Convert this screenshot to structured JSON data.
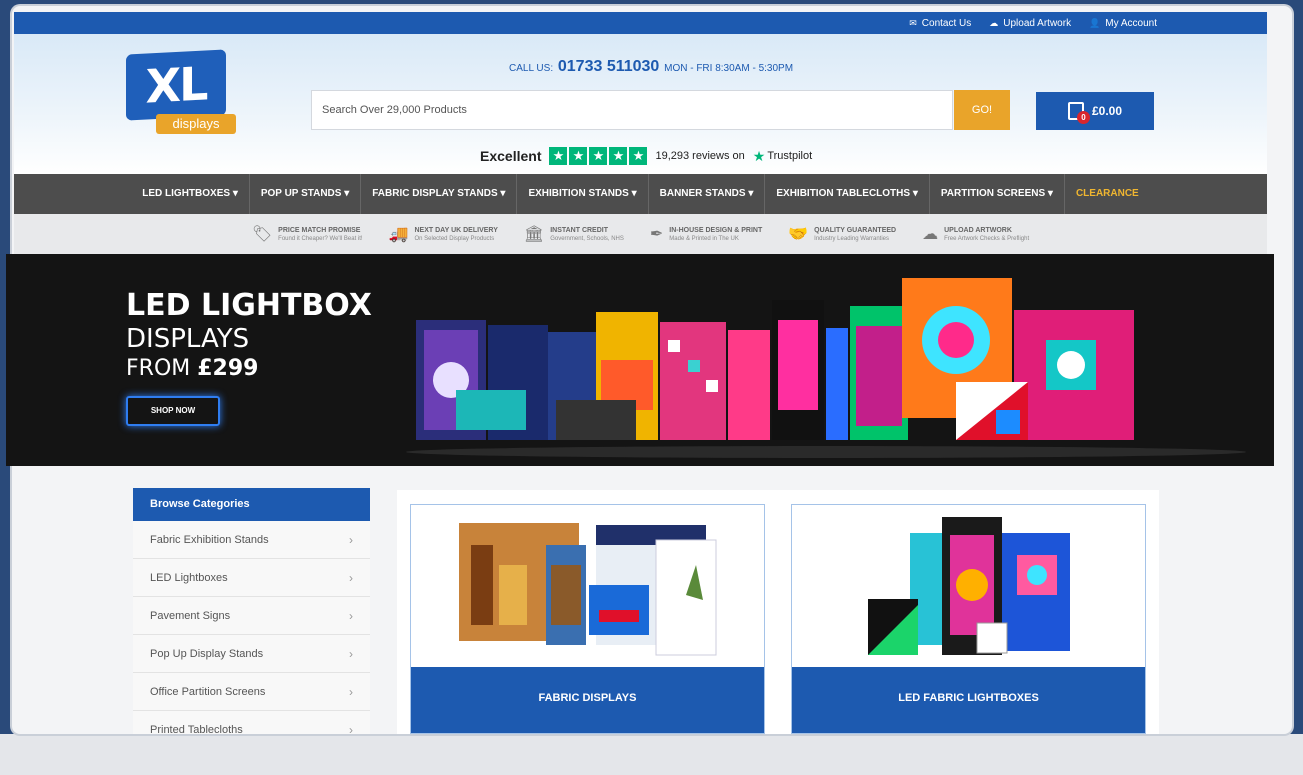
{
  "topbar": {
    "links": [
      {
        "label": "Contact Us",
        "icon": "envelope-icon"
      },
      {
        "label": "Upload Artwork",
        "icon": "cloud-upload-icon"
      },
      {
        "label": "My Account",
        "icon": "user-icon"
      }
    ]
  },
  "header": {
    "logo_main": "XL",
    "logo_sub": "displays",
    "call_label": "CALL US:",
    "phone": "01733 511030",
    "hours": "MON - FRI 8:30AM - 5:30PM",
    "search_placeholder": "Search Over 29,000 Products",
    "search_button": "GO!",
    "cart_total": "£0.00",
    "cart_count": "0",
    "trust_word": "Excellent",
    "trust_reviews": "19,293 reviews on",
    "trust_brand": "Trustpilot"
  },
  "nav": [
    "LED LIGHTBOXES ▾",
    "POP UP STANDS ▾",
    "FABRIC DISPLAY STANDS ▾",
    "EXHIBITION STANDS ▾",
    "BANNER STANDS ▾",
    "EXHIBITION TABLECLOTHS ▾",
    "PARTITION SCREENS ▾",
    "CLEARANCE"
  ],
  "usps": [
    {
      "title": "PRICE MATCH PROMISE",
      "sub": "Found it Cheaper? We'll Beat it!",
      "icon": "price-tag-icon"
    },
    {
      "title": "NEXT DAY UK DELIVERY",
      "sub": "On Selected Display Products",
      "icon": "truck-icon"
    },
    {
      "title": "INSTANT CREDIT",
      "sub": "Government, Schools, NHS",
      "icon": "building-icon"
    },
    {
      "title": "IN-HOUSE DESIGN & PRINT",
      "sub": "Made & Printed in The UK",
      "icon": "pen-icon"
    },
    {
      "title": "QUALITY GUARANTEED",
      "sub": "Industry Leading Warranties",
      "icon": "handshake-icon"
    },
    {
      "title": "UPLOAD ARTWORK",
      "sub": "Free Artwork Checks & Preflight",
      "icon": "cloud-upload-icon"
    }
  ],
  "hero": {
    "line1": "LED LIGHTBOX",
    "line2": "DISPLAYS",
    "line3_prefix": "FROM ",
    "line3_price": "£299",
    "cta": "SHOP NOW"
  },
  "sidebar": {
    "heading": "Browse Categories",
    "items": [
      "Fabric Exhibition Stands",
      "LED Lightboxes",
      "Pavement Signs",
      "Pop Up Display Stands",
      "Office Partition Screens",
      "Printed Tablecloths"
    ]
  },
  "products": [
    {
      "label": "FABRIC DISPLAYS"
    },
    {
      "label": "LED FABRIC LIGHTBOXES"
    }
  ],
  "colors": {
    "brand_blue": "#1d5ab0",
    "accent_orange": "#e9a42a",
    "nav_grey": "#4d4d4d",
    "clearance": "#f0b630",
    "trustpilot_green": "#00b67a"
  }
}
